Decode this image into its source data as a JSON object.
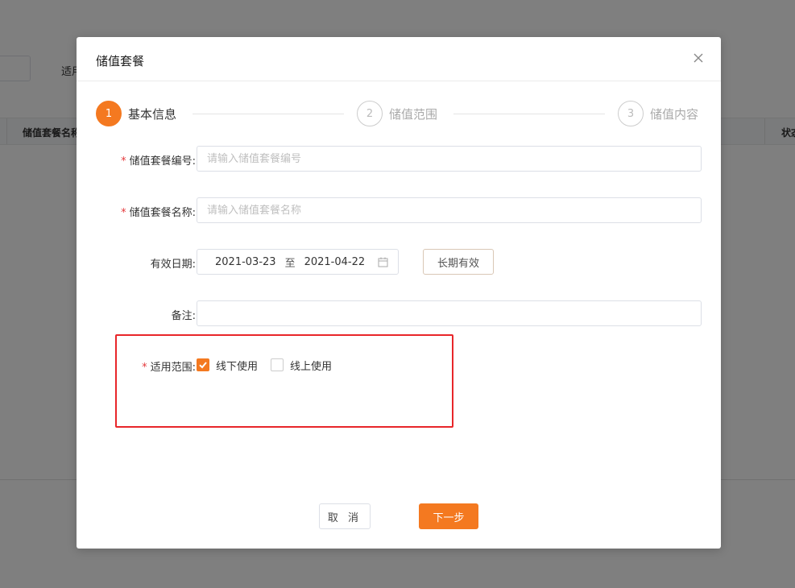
{
  "background": {
    "filter_label": "适用",
    "table_columns": [
      "储值套餐名称",
      "状态"
    ]
  },
  "modal": {
    "title": "储值套餐",
    "steps": [
      {
        "number": "1",
        "label": "基本信息",
        "active": true
      },
      {
        "number": "2",
        "label": "储值范围",
        "active": false
      },
      {
        "number": "3",
        "label": "储值内容",
        "active": false
      }
    ],
    "form": {
      "code": {
        "label": "储值套餐编号",
        "required": true,
        "placeholder": "请输入储值套餐编号",
        "value": ""
      },
      "name": {
        "label": "储值套餐名称",
        "required": true,
        "placeholder": "请输入储值套餐名称",
        "value": ""
      },
      "valid_date": {
        "label": "有效日期",
        "start": "2021-03-23",
        "separator": "至",
        "end": "2021-04-22",
        "long_term_label": "长期有效"
      },
      "remark": {
        "label": "备注",
        "value": ""
      },
      "scope": {
        "label": "适用范围",
        "required": true,
        "options": [
          {
            "label": "线下使用",
            "checked": true
          },
          {
            "label": "线上使用",
            "checked": false
          }
        ]
      }
    },
    "buttons": {
      "cancel": "取 消",
      "next": "下一步"
    }
  },
  "colors": {
    "accent": "#f47920",
    "highlight": "#e8262a",
    "required": "#e4393c"
  }
}
